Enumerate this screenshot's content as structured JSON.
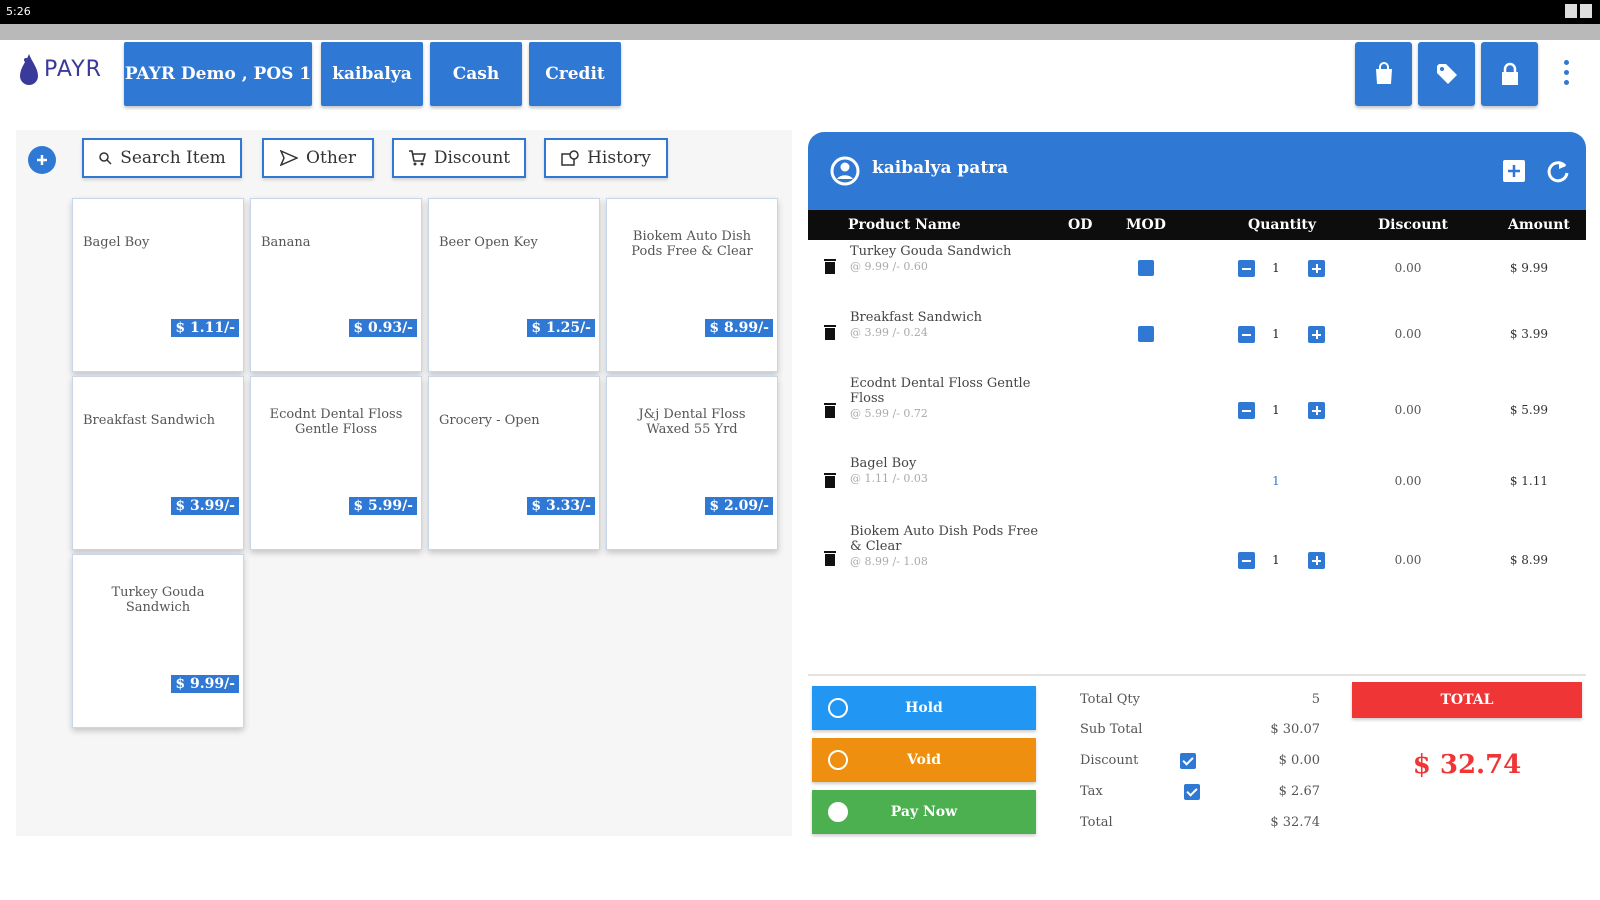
{
  "status_bar": {
    "time": "5:26"
  },
  "app": {
    "logo_text": "PAYR"
  },
  "topbar": {
    "store_label": "PAYR Demo , POS 1",
    "customer_label": "kaibalya",
    "cash_label": "Cash",
    "credit_label": "Credit",
    "icons": [
      "shopping-bag-icon",
      "tag-icon",
      "lock-icon",
      "more-vert-icon"
    ]
  },
  "toolbar": {
    "search_label": "Search Item",
    "other_label": "Other",
    "discount_label": "Discount",
    "history_label": "History"
  },
  "products": [
    {
      "name": "Bagel Boy",
      "price": "$ 1.11/-"
    },
    {
      "name": "Banana",
      "price": "$ 0.93/-"
    },
    {
      "name": "Beer Open Key",
      "price": "$ 1.25/-"
    },
    {
      "name": "Biokem Auto Dish Pods Free & Clear",
      "price": "$ 8.99/-"
    },
    {
      "name": "Breakfast Sandwich",
      "price": "$ 3.99/-"
    },
    {
      "name": "Ecodnt Dental Floss Gentle Floss",
      "price": "$ 5.99/-"
    },
    {
      "name": "Grocery - Open",
      "price": "$ 3.33/-"
    },
    {
      "name": "J&j Dental Floss Waxed 55 Yrd",
      "price": "$ 2.09/-"
    },
    {
      "name": "Turkey Gouda Sandwich",
      "price": "$ 9.99/-"
    }
  ],
  "cart": {
    "customer_name": "kaibalya patra",
    "columns": {
      "product": "Product Name",
      "od": "OD",
      "mod": "MOD",
      "quantity": "Quantity",
      "discount": "Discount",
      "amount": "Amount"
    },
    "items": [
      {
        "name": "Turkey Gouda Sandwich",
        "sub": "@ 9.99 /-   0.60",
        "qty": "1",
        "discount": "0.00",
        "amount": "$ 9.99"
      },
      {
        "name": "Breakfast Sandwich",
        "sub": "@ 3.99 /-   0.24",
        "qty": "1",
        "discount": "0.00",
        "amount": "$ 3.99"
      },
      {
        "name": "Ecodnt Dental Floss Gentle Floss",
        "sub": "@ 5.99 /-   0.72",
        "qty": "1",
        "discount": "0.00",
        "amount": "$ 5.99"
      },
      {
        "name": "Bagel Boy",
        "sub": "@ 1.11 /-   0.03",
        "qty": "1",
        "discount": "0.00",
        "amount": "$ 1.11"
      },
      {
        "name": "Biokem Auto Dish Pods Free & Clear",
        "sub": "@ 8.99 /-   1.08",
        "qty": "1",
        "discount": "0.00",
        "amount": "$ 8.99"
      }
    ]
  },
  "actions": {
    "hold": "Hold",
    "void": "Void",
    "pay_now": "Pay Now"
  },
  "summary": {
    "total_qty_label": "Total Qty",
    "total_qty": "5",
    "sub_total_label": "Sub Total",
    "sub_total": "$ 30.07",
    "discount_label": "Discount",
    "discount": "$ 0.00",
    "tax_label": "Tax",
    "tax": "$ 2.67",
    "total_label": "Total",
    "total": "$ 32.74",
    "total_button": "TOTAL",
    "grand_total": "$ 32.74"
  },
  "colors": {
    "primary": "#2f78d3",
    "hold": "#2196f3",
    "void": "#ee8f10",
    "pay": "#4caf50",
    "total": "#ef3535"
  }
}
